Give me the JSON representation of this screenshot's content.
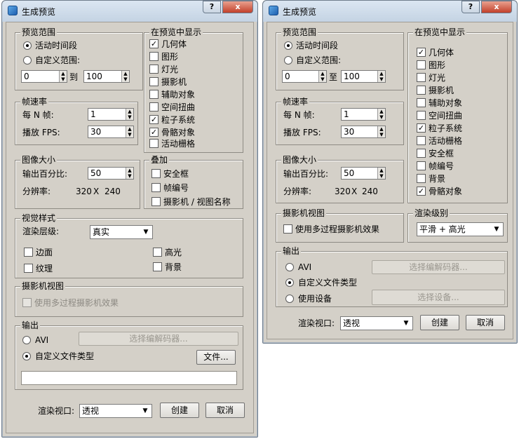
{
  "left": {
    "title": "生成预览",
    "help": "?",
    "close": "x",
    "range": {
      "title": "预览范围",
      "active": "活动时间段",
      "custom": "自定义范围:",
      "from": "0",
      "to_label": "到",
      "to": "100"
    },
    "rate": {
      "title": "帧速率",
      "every_n": "每 N 帧:",
      "every_n_val": "1",
      "fps": "播放 FPS:",
      "fps_val": "30"
    },
    "show": {
      "title": "在预览中显示",
      "items": [
        {
          "label": "几何体",
          "checked": "✓"
        },
        {
          "label": "图形",
          "checked": ""
        },
        {
          "label": "灯光",
          "checked": ""
        },
        {
          "label": "摄影机",
          "checked": ""
        },
        {
          "label": "辅助对象",
          "checked": ""
        },
        {
          "label": "空间扭曲",
          "checked": ""
        },
        {
          "label": "粒子系统",
          "checked": "✓"
        },
        {
          "label": "骨骼对象",
          "checked": "✓"
        },
        {
          "label": "活动栅格",
          "checked": ""
        }
      ]
    },
    "size": {
      "title": "图像大小",
      "percent": "输出百分比:",
      "percent_val": "50",
      "res": "分辨率:",
      "w": "320",
      "x": "X",
      "h": "240"
    },
    "overlay": {
      "title": "叠加",
      "items": [
        {
          "label": "安全框",
          "checked": ""
        },
        {
          "label": "帧编号",
          "checked": ""
        },
        {
          "label": "摄影机 / 视图名称",
          "checked": ""
        }
      ]
    },
    "visual": {
      "title": "视觉样式",
      "level": "渲染层级:",
      "level_val": "真实",
      "edges": "边面",
      "highlight": "高光",
      "texture": "纹理",
      "background": "背景"
    },
    "camera": {
      "title": "摄影机视图",
      "multipass": "使用多过程摄影机效果"
    },
    "output": {
      "title": "输出",
      "avi": "AVI",
      "codec": "选择编解码器...",
      "custom": "自定义文件类型",
      "file": "文件...",
      "path": ""
    },
    "footer": {
      "viewport_label": "渲染视口:",
      "viewport": "透视",
      "create": "创建",
      "cancel": "取消"
    }
  },
  "right": {
    "title": "生成预览",
    "help": "?",
    "close": "x",
    "range": {
      "title": "预览范围",
      "active": "活动时间段",
      "custom": "自定义范围:",
      "from": "0",
      "to_label": "至",
      "to": "100"
    },
    "rate": {
      "title": "帧速率",
      "every_n": "每 N 帧:",
      "every_n_val": "1",
      "fps": "播放 FPS:",
      "fps_val": "30"
    },
    "show": {
      "title": "在预览中显示",
      "items": [
        {
          "label": "几何体",
          "checked": "✓"
        },
        {
          "label": "图形",
          "checked": ""
        },
        {
          "label": "灯光",
          "checked": ""
        },
        {
          "label": "摄影机",
          "checked": ""
        },
        {
          "label": "辅助对象",
          "checked": ""
        },
        {
          "label": "空间扭曲",
          "checked": ""
        },
        {
          "label": "粒子系统",
          "checked": "✓"
        },
        {
          "label": "活动栅格",
          "checked": ""
        },
        {
          "label": "安全框",
          "checked": ""
        },
        {
          "label": "帧编号",
          "checked": ""
        },
        {
          "label": "背景",
          "checked": ""
        },
        {
          "label": "骨骼对象",
          "checked": "✓"
        }
      ]
    },
    "size": {
      "title": "图像大小",
      "percent": "输出百分比:",
      "percent_val": "50",
      "res": "分辨率:",
      "w": "320",
      "x": "X",
      "h": "240"
    },
    "camera": {
      "title": "摄影机视图",
      "multipass": "使用多过程摄影机效果"
    },
    "level": {
      "title": "渲染级别",
      "val": "平滑 + 高光"
    },
    "output": {
      "title": "输出",
      "avi": "AVI",
      "codec": "选择编解码器...",
      "custom": "自定义文件类型",
      "device": "使用设备",
      "select_device": "选择设备..."
    },
    "footer": {
      "viewport_label": "渲染视口:",
      "viewport": "透视",
      "create": "创建",
      "cancel": "取消"
    }
  }
}
